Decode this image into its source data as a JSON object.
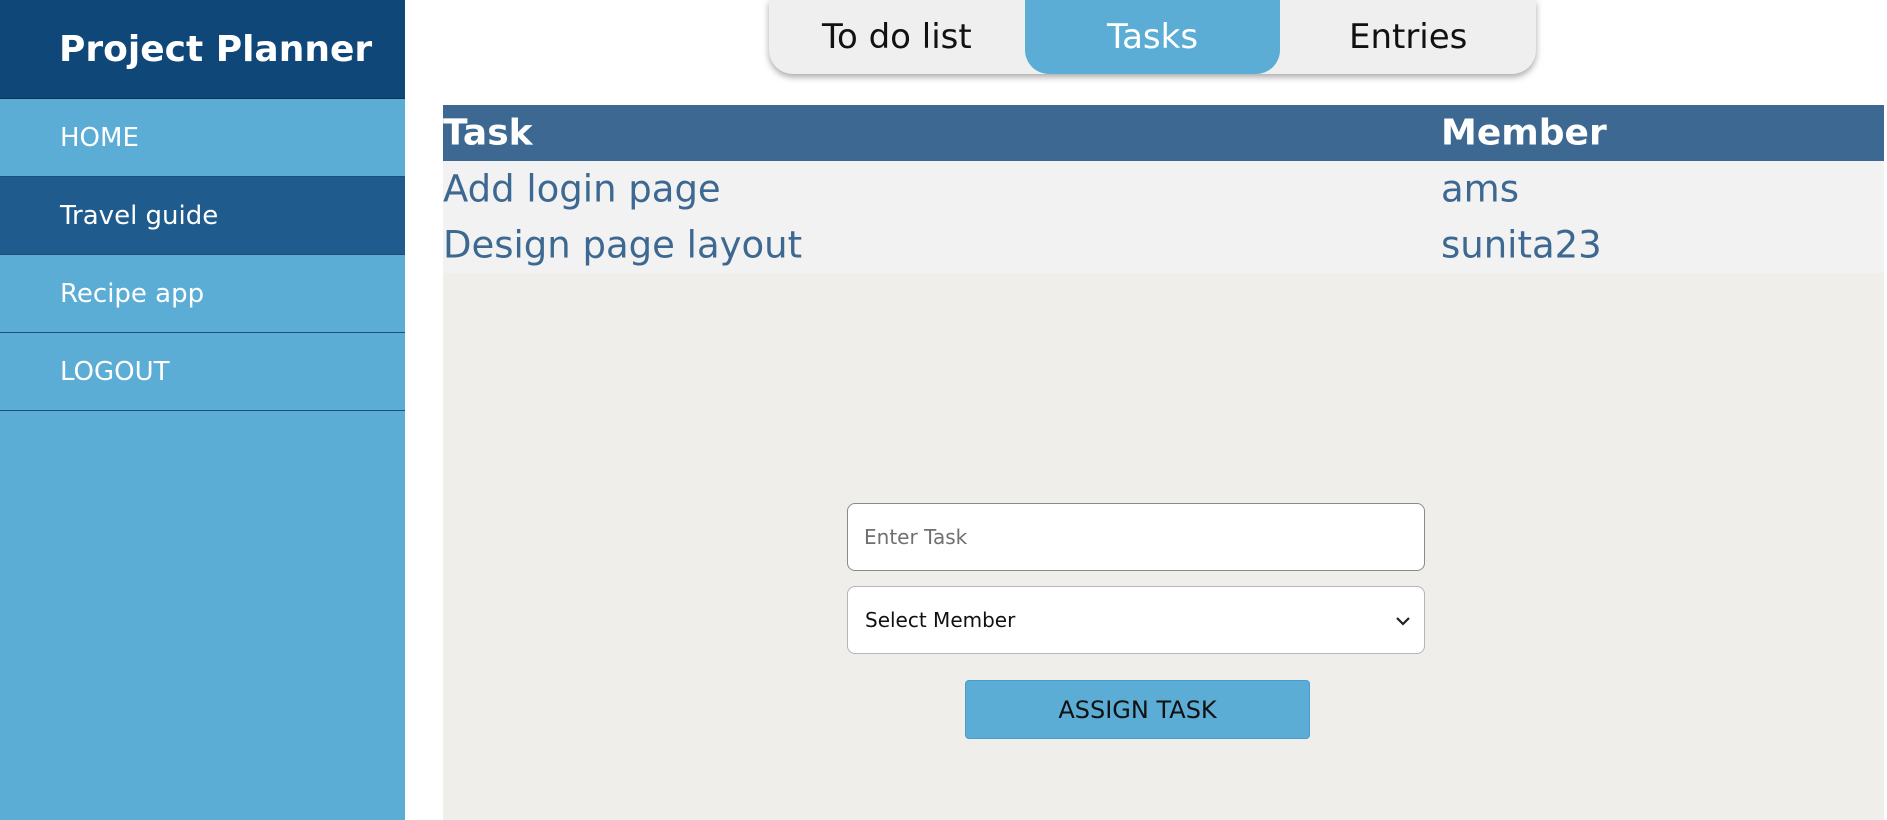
{
  "app": {
    "title": "Project Planner"
  },
  "sidebar": {
    "items": [
      {
        "label": "HOME"
      },
      {
        "label": "Travel guide"
      },
      {
        "label": "Recipe app"
      },
      {
        "label": "LOGOUT"
      }
    ]
  },
  "tabs": [
    {
      "label": "To do list"
    },
    {
      "label": "Tasks"
    },
    {
      "label": "Entries"
    }
  ],
  "table": {
    "headers": [
      "Task",
      "Member"
    ],
    "rows": [
      {
        "task": "Add login page",
        "member": "ams"
      },
      {
        "task": "Design page layout",
        "member": "sunita23"
      }
    ]
  },
  "form": {
    "task_placeholder": "Enter Task",
    "member_select_value": "Select Member",
    "assign_label": "ASSIGN TASK"
  },
  "colors": {
    "sidebar": "#5badd5",
    "brand_bg": "#0f4878",
    "active_nav": "#1f5b8d",
    "table_header": "#3d6891",
    "accent": "#5badd5"
  },
  "icons": {
    "select_arrow": "chevron-down-icon"
  }
}
